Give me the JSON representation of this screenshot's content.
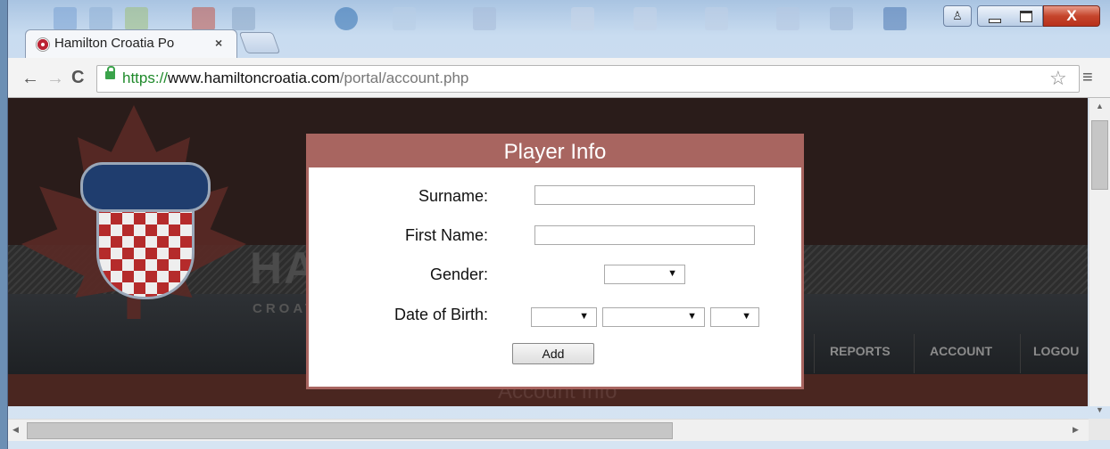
{
  "browser": {
    "tab_title": "Hamilton Croatia Po",
    "tab_close": "×",
    "url_scheme": "https://",
    "url_domain": "www.hamiltoncroatia.com",
    "url_path": "/portal/account.php",
    "star_icon": "☆",
    "menu_icon": "≡",
    "back_icon": "←",
    "forward_icon": "→",
    "reload_icon": "C",
    "window_close": "X",
    "profile_icon": "♙"
  },
  "site": {
    "name": "HA",
    "subtitle": "CROAT",
    "nav": [
      "REPORTS",
      "ACCOUNT",
      "LOGOU"
    ],
    "section_title": "Account Info"
  },
  "modal": {
    "title": "Player Info",
    "labels": {
      "surname": "Surname:",
      "first_name": "First Name:",
      "gender": "Gender:",
      "dob": "Date of Birth:"
    },
    "values": {
      "surname": "",
      "first_name": "",
      "gender": "",
      "dob_day": "",
      "dob_month": "",
      "dob_year": ""
    },
    "add_label": "Add"
  },
  "colors": {
    "modal_accent": "#a86560",
    "page_bg": "#2a1c1a",
    "url_secure": "#1f8a2b"
  }
}
